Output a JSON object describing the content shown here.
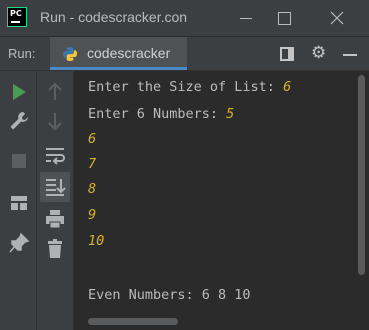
{
  "window": {
    "title": "Run - codescracker.con",
    "app_icon_label": "PC"
  },
  "run_panel": {
    "label": "Run:",
    "tab_name": "codescracker",
    "tab_close": "—"
  },
  "console": {
    "prompt_size": "Enter the Size of List: ",
    "size_value": "6",
    "prompt_numbers": "Enter 6 Numbers: ",
    "first_number": "5",
    "numbers": [
      "6",
      "7",
      "8",
      "9",
      "10"
    ],
    "result": "Even Numbers: 6 8 10"
  },
  "colors": {
    "input_text": "#d6b12a",
    "output_text": "#bbbbbb",
    "run_green": "#499c54",
    "tab_accent": "#4a88c7"
  },
  "icons": [
    "run-icon",
    "wrench-icon",
    "stop-icon",
    "layout-icon",
    "pin-icon",
    "up-arrow-icon",
    "down-arrow-icon",
    "soft-wrap-icon",
    "scroll-to-end-icon",
    "print-icon",
    "trash-icon",
    "gear-icon",
    "minimize-icon",
    "python-icon"
  ]
}
